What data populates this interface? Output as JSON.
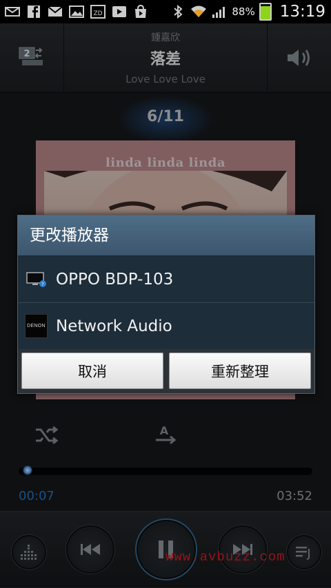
{
  "status_bar": {
    "battery_percent": "88%",
    "battery_level": 0.88,
    "time": "13:19",
    "icons": [
      "email-icon",
      "facebook-icon",
      "gmail-icon",
      "gallery-icon",
      "zd-icon",
      "play-icon",
      "play-store-icon",
      "bluetooth-icon",
      "wifi-icon",
      "signal-icon",
      "battery-icon"
    ],
    "zd_label": "ZD"
  },
  "header": {
    "artist": "鍾嘉欣",
    "song_title": "落差",
    "album": "Love Love Love",
    "left_icon": "device-select-icon",
    "device_badge": "2",
    "right_icon": "volume-icon"
  },
  "track_counter": "6/11",
  "album_art": {
    "logo_text": "linda linda linda"
  },
  "dialog": {
    "title": "更改播放器",
    "items": [
      {
        "label": "OPPO BDP-103",
        "icon": "monitor-icon"
      },
      {
        "label": "Network Audio",
        "icon": "denon-icon",
        "icon_text": "DENON"
      }
    ],
    "buttons": {
      "cancel": "取消",
      "refresh": "重新整理"
    }
  },
  "controls": {
    "shuffle_icon": "shuffle-icon",
    "repeat_icon": "repeat-a-icon",
    "repeat_letter": "A"
  },
  "playback": {
    "elapsed": "00:07",
    "total": "03:52",
    "progress": 0.03
  },
  "bottom_bar": {
    "icons": [
      "equalizer-icon",
      "previous-icon",
      "pause-icon",
      "next-icon",
      "playlist-icon"
    ]
  },
  "watermark": "www.avbuzz.com",
  "colors": {
    "accent_blue": "#2a7ac9",
    "dialog_title_bg": "#4e6d87",
    "battery_green": "#8ed41a",
    "watermark_red": "#e0202a"
  }
}
